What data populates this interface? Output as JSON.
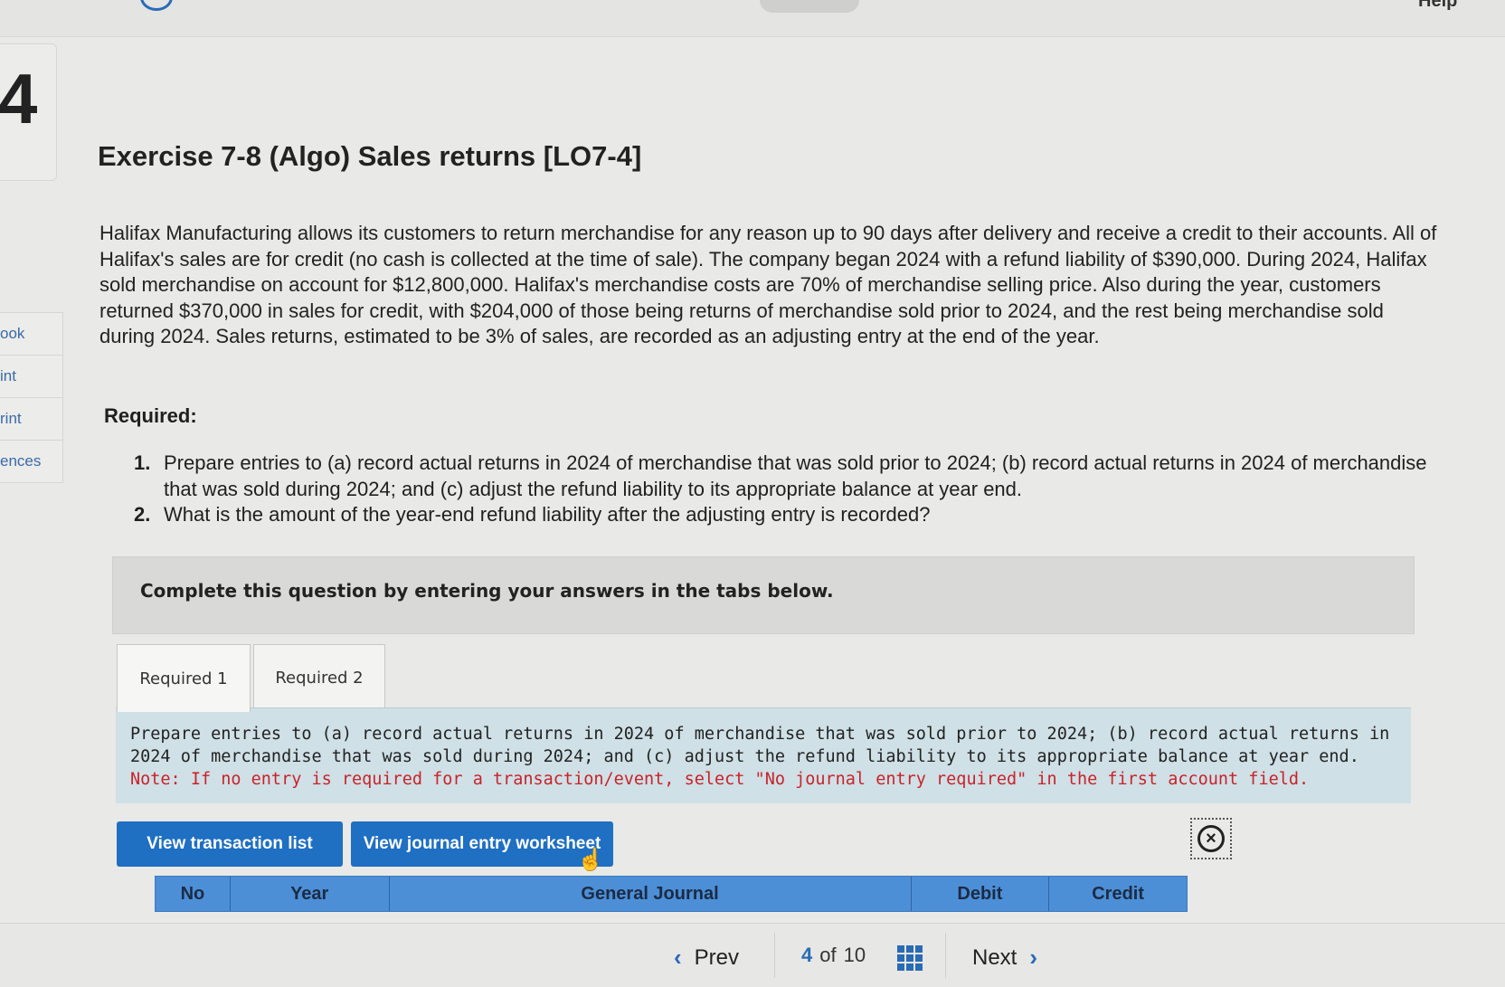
{
  "top": {
    "help_fragment": "Help"
  },
  "question_number": "4",
  "side_nav": [
    "ook",
    "int",
    "rint",
    "ences"
  ],
  "exercise": {
    "title": "Exercise 7-8 (Algo) Sales returns [LO7-4]",
    "description": "Halifax Manufacturing allows its customers to return merchandise for any reason up to 90 days after delivery and receive a credit to their accounts. All of Halifax's sales are for credit (no cash is collected at the time of sale). The company began 2024 with a refund liability of $390,000. During 2024, Halifax sold merchandise on account for $12,800,000. Halifax's merchandise costs are 70% of merchandise selling price. Also during the year, customers returned $370,000 in sales for credit, with $204,000 of those being returns of merchandise sold prior to 2024, and the rest being merchandise sold during 2024. Sales returns, estimated to be 3% of sales, are recorded as an adjusting entry at the end of the year.",
    "required_label": "Required:",
    "requirements": [
      {
        "num": "1.",
        "text": "Prepare entries to (a) record actual returns in 2024 of merchandise that was sold prior to 2024; (b) record actual returns in 2024 of merchandise that was sold during 2024; and (c) adjust the refund liability to its appropriate balance at year end."
      },
      {
        "num": "2.",
        "text": "What is the amount of the year-end refund liability after the adjusting entry is recorded?"
      }
    ]
  },
  "complete_box": "Complete this question by entering your answers in the tabs below.",
  "tabs": [
    "Required 1",
    "Required 2"
  ],
  "instructions": {
    "text": "Prepare entries to (a) record actual returns in 2024 of merchandise that was sold prior to 2024; (b) record actual returns in 2024 of merchandise that was sold during 2024; and (c) adjust the refund liability to its appropriate balance at year end.",
    "note": "Note: If no entry is required for a transaction/event, select \"No journal entry required\" in the first account field."
  },
  "buttons": {
    "transaction_list": "View transaction list",
    "worksheet": "View journal entry worksheet",
    "close_icon": "circle-x-icon"
  },
  "journal_table": {
    "headers": [
      "No",
      "Year",
      "General Journal",
      "Debit",
      "Credit"
    ]
  },
  "pagination": {
    "prev": "Prev",
    "current": "4",
    "of": "of",
    "total": "10",
    "next": "Next"
  },
  "colors": {
    "accent": "#1f6fc2",
    "table_header": "#4d8fd6",
    "instruction_bg": "#cfe0e6",
    "note_red": "#c8232a"
  }
}
